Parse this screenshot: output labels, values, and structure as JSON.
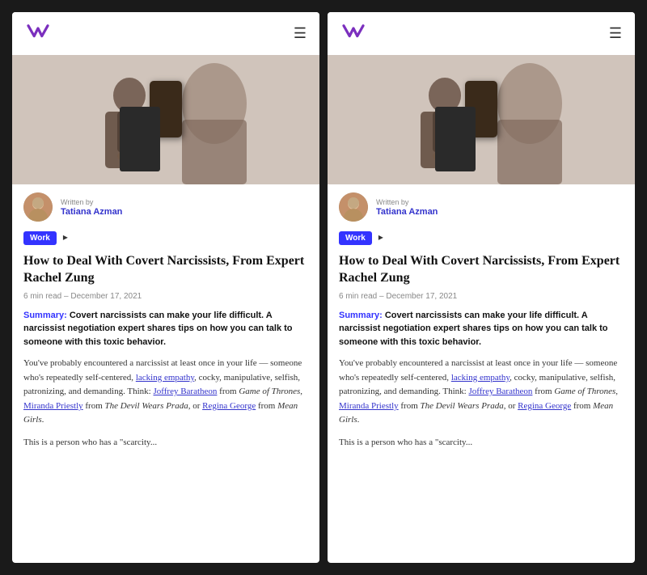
{
  "panels": [
    {
      "id": "left",
      "nav": {
        "logo_alt": "Wondermind logo",
        "menu_label": "☰"
      },
      "author": {
        "written_by": "Written by",
        "name": "Tatiana Azman"
      },
      "tag": "Work",
      "article": {
        "title": "How to Deal With Covert Narcissists, From Expert Rachel Zung",
        "meta": "6 min read  –  December 17, 2021",
        "summary_label": "Summary:",
        "summary_text": " Covert narcissists can make your life difficult. A narcissist negotiation expert shares tips on how you can talk to someone with this toxic behavior.",
        "body1": "You've probably encountered a narcissist at least once in your life — someone who's repeatedly self-centered, ",
        "link1": "lacking empathy",
        "body2": ", cocky, manipulative, selfish, patronizing, and demanding. Think: ",
        "link2": "Joffrey Baratheon",
        "body3": " from ",
        "italic1": "Game of Thrones",
        "body4": ", ",
        "link3": "Miranda Priestly",
        "body5": " from ",
        "italic2": "The Devil Wears Prada",
        "body6": ", or ",
        "link4": "Regina George",
        "body7": " from ",
        "italic3": "Mean Girls",
        "body8": ".",
        "body9": "This is a person who has a \"scarcity..."
      }
    },
    {
      "id": "right",
      "nav": {
        "logo_alt": "Wondermind logo",
        "menu_label": "☰"
      },
      "author": {
        "written_by": "Written by",
        "name": "Tatiana Azman"
      },
      "tag": "Work",
      "article": {
        "title": "How to Deal With Covert Narcissists, From Expert Rachel Zung",
        "meta": "6 min read  –  December 17, 2021",
        "summary_label": "Summary:",
        "summary_text": " Covert narcissists can make your life difficult. A narcissist negotiation expert shares tips on how you can talk to someone with this toxic behavior.",
        "body1": "You've probably encountered a narcissist at least once in your life — someone who's repeatedly self-centered, ",
        "link1": "lacking empathy",
        "body2": ", cocky, manipulative, selfish, patronizing, and demanding. Think: ",
        "link2": "Joffrey Baratheon",
        "body3": " from ",
        "italic1": "Game of Thrones",
        "body4": ", ",
        "link3": "Miranda Priestly",
        "body5": " from ",
        "italic2": "The Devil Wears Prada",
        "body6": ", or ",
        "link4": "Regina George",
        "body7": " from ",
        "italic3": "Mean Girls",
        "body8": ".",
        "body9": "This is a person who has a \"scarcity..."
      }
    }
  ],
  "colors": {
    "accent": "#3333ff",
    "link": "#3333cc",
    "tag_bg": "#3333ff",
    "tag_text": "#ffffff",
    "title_color": "#111111",
    "meta_color": "#888888",
    "body_color": "#333333"
  }
}
